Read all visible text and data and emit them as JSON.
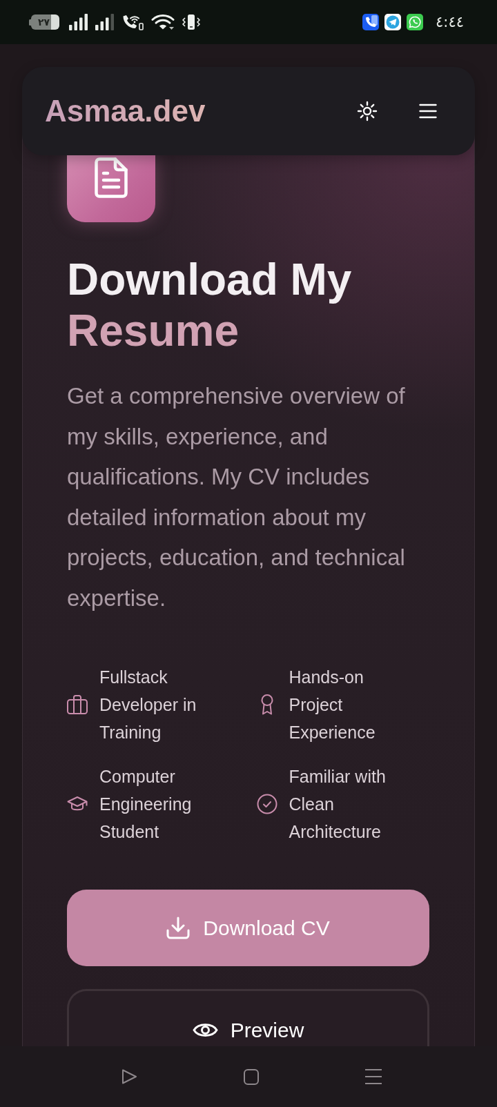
{
  "status_bar": {
    "battery": "٢٧",
    "time": "٤:٤٤"
  },
  "header": {
    "logo": "Asmaa.dev"
  },
  "hero": {
    "title": "Download My",
    "title_highlight": "Resume",
    "description": "Get a comprehensive overview of my skills, experience, and qualifications. My CV includes detailed information about my projects, education, and technical expertise."
  },
  "features": [
    "Fullstack Developer in Training",
    "Hands-on Project Experience",
    "Computer Engineering Student",
    "Familiar with Clean Architecture"
  ],
  "buttons": [
    {
      "kind": "primary",
      "label": "Download CV"
    },
    {
      "kind": "outline",
      "label": "Preview"
    }
  ]
}
